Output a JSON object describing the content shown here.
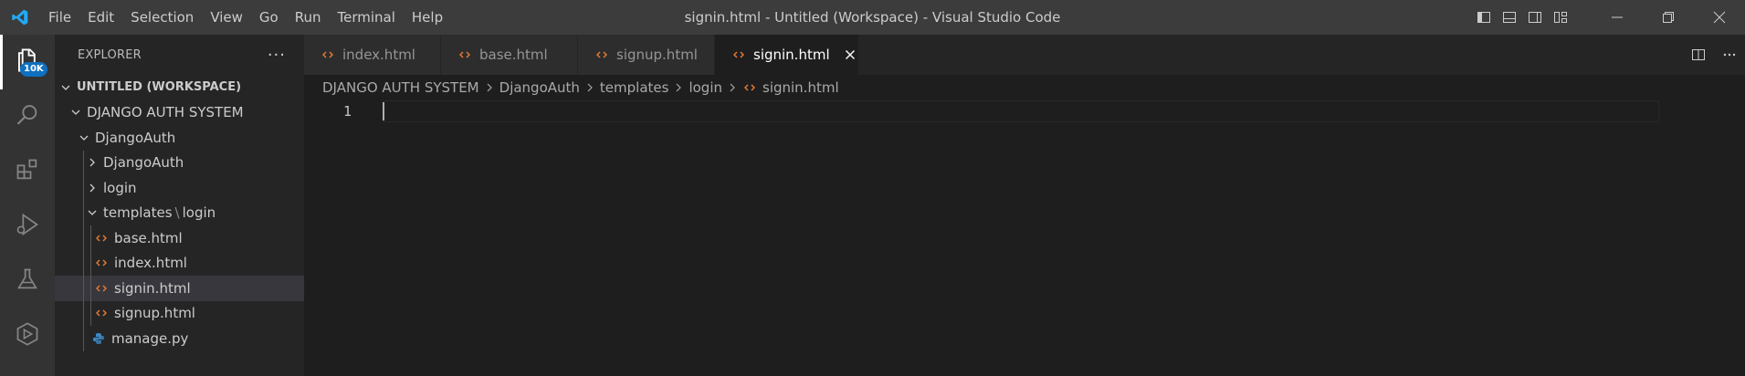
{
  "titlebar": {
    "menu": [
      "File",
      "Edit",
      "Selection",
      "View",
      "Go",
      "Run",
      "Terminal",
      "Help"
    ],
    "window_title": "signin.html - Untitled (Workspace) - Visual Studio Code"
  },
  "activitybar": {
    "explorer_badge": "10K",
    "items": [
      "explorer-icon",
      "search-icon",
      "extensions-icon",
      "run-debug-icon",
      "testing-icon",
      "remote-explorer-icon"
    ]
  },
  "sidebar": {
    "title": "EXPLORER",
    "more": "···",
    "workspace": "UNTITLED (WORKSPACE)",
    "root_folder": "DJANGO AUTH SYSTEM",
    "project": "DjangoAuth",
    "subfolder_1": "DjangoAuth",
    "subfolder_2": "login",
    "templates_folder": "templates",
    "templates_sub": "login",
    "templates_sep": "\\",
    "files": [
      "base.html",
      "index.html",
      "signin.html",
      "signup.html"
    ],
    "manage": "manage.py"
  },
  "tabs": [
    "index.html",
    "base.html",
    "signup.html",
    "signin.html"
  ],
  "breadcrumb": [
    "DJANGO AUTH SYSTEM",
    "DjangoAuth",
    "templates",
    "login",
    "signin.html"
  ],
  "editor": {
    "line_number": "1"
  },
  "colors": {
    "titlebar": "#3c3c3c",
    "activitybar": "#333333",
    "sidebar": "#252526",
    "editor": "#1e1e1e",
    "html_icon": "#e37933",
    "python_icon": "#3b88c3",
    "badge": "#0e70c0"
  }
}
